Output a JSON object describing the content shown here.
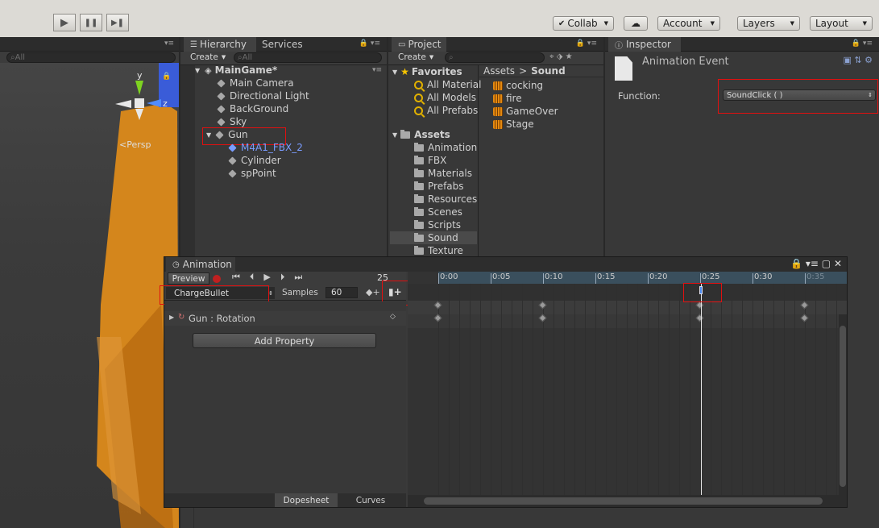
{
  "toolbar": {
    "collab": "Collab",
    "account": "Account",
    "layers": "Layers",
    "layout": "Layout",
    "play": "▶",
    "pause": "❚❚",
    "step": "▶❚"
  },
  "scene": {
    "search_placeholder": "All",
    "gizmo_y": "y",
    "gizmo_z": "z",
    "persp": "Persp"
  },
  "hierarchy": {
    "tab": "Hierarchy",
    "tab2": "Services",
    "create": "Create",
    "search": "All",
    "scene_name": "MainGame*",
    "items": [
      "Main Camera",
      "Directional Light",
      "BackGround",
      "Sky",
      "Gun",
      "M4A1_FBX_2",
      "Cylinder",
      "spPoint"
    ]
  },
  "project": {
    "tab": "Project",
    "create": "Create",
    "favorites": "Favorites",
    "fav_items": [
      "All Material",
      "All Models",
      "All Prefabs"
    ],
    "assets": "Assets",
    "asset_folders": [
      "Animation",
      "FBX",
      "Materials",
      "Prefabs",
      "Resources",
      "Scenes",
      "Scripts",
      "Sound",
      "Texture"
    ],
    "breadcrumb": [
      "Assets",
      "Sound"
    ],
    "sound_files": [
      "cocking",
      "fire",
      "GameOver",
      "Stage"
    ]
  },
  "inspector": {
    "tab": "Inspector",
    "title": "Animation Event",
    "function_label": "Function:",
    "function_value": "SoundClick ( )"
  },
  "animation": {
    "tab": "Animation",
    "preview": "Preview",
    "frame": "25",
    "clip": "ChargeBullet",
    "samples_label": "Samples",
    "samples": "60",
    "property": "Gun : Rotation",
    "add_property": "Add Property",
    "dopesheet": "Dopesheet",
    "curves": "Curves",
    "ticks": [
      "0:00",
      "0:05",
      "0:10",
      "0:15",
      "0:20",
      "0:25",
      "0:30",
      "0:35"
    ]
  },
  "colors": {
    "accent_red": "#e01010",
    "audio_orange": "#e58a10",
    "object_blue": "#7a9cff"
  }
}
